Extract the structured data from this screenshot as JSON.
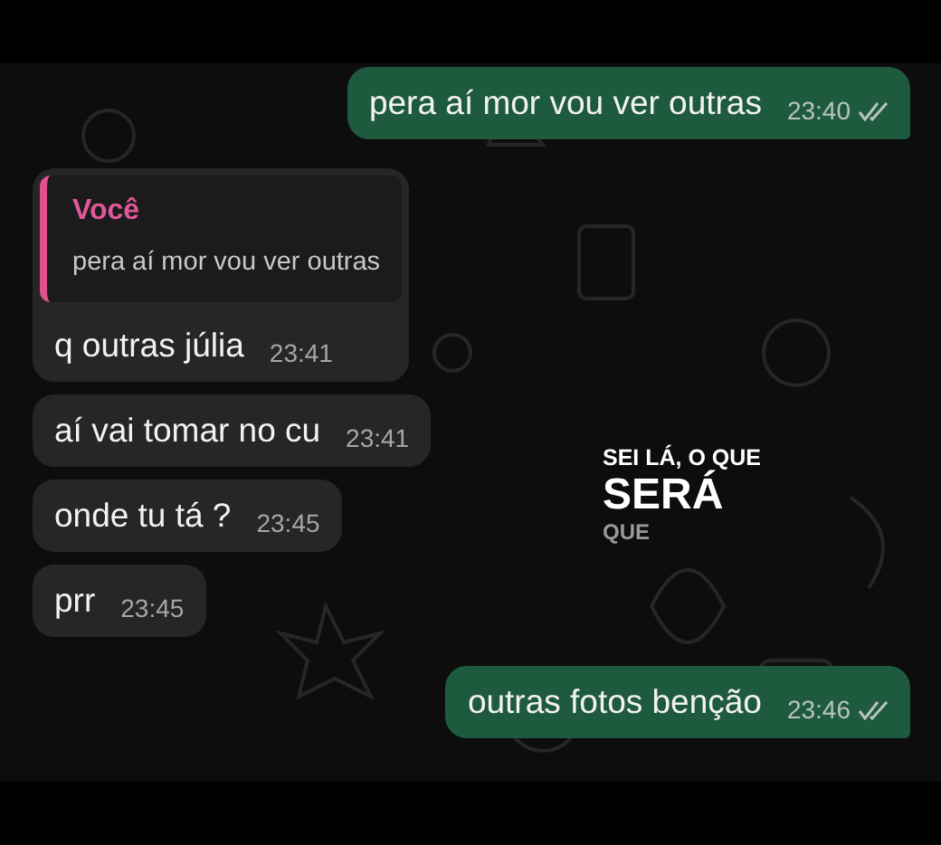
{
  "messages": [
    {
      "kind": "sent",
      "text": "pera aí mor vou ver outras",
      "time": "23:40",
      "read": false
    },
    {
      "kind": "received",
      "quote": {
        "author": "Você",
        "text": "pera aí mor vou ver outras"
      },
      "text": "q outras júlia",
      "time": "23:41"
    },
    {
      "kind": "received",
      "text": "aí vai tomar no cu",
      "time": "23:41"
    },
    {
      "kind": "received",
      "text": "onde tu tá ?",
      "time": "23:45"
    },
    {
      "kind": "received",
      "text": "prr",
      "time": "23:45"
    },
    {
      "kind": "sent",
      "text": "outras fotos benção",
      "time": "23:46",
      "read": false
    }
  ],
  "caption": [
    "SEI LÁ, O QUE",
    "SERÁ",
    "QUE"
  ]
}
